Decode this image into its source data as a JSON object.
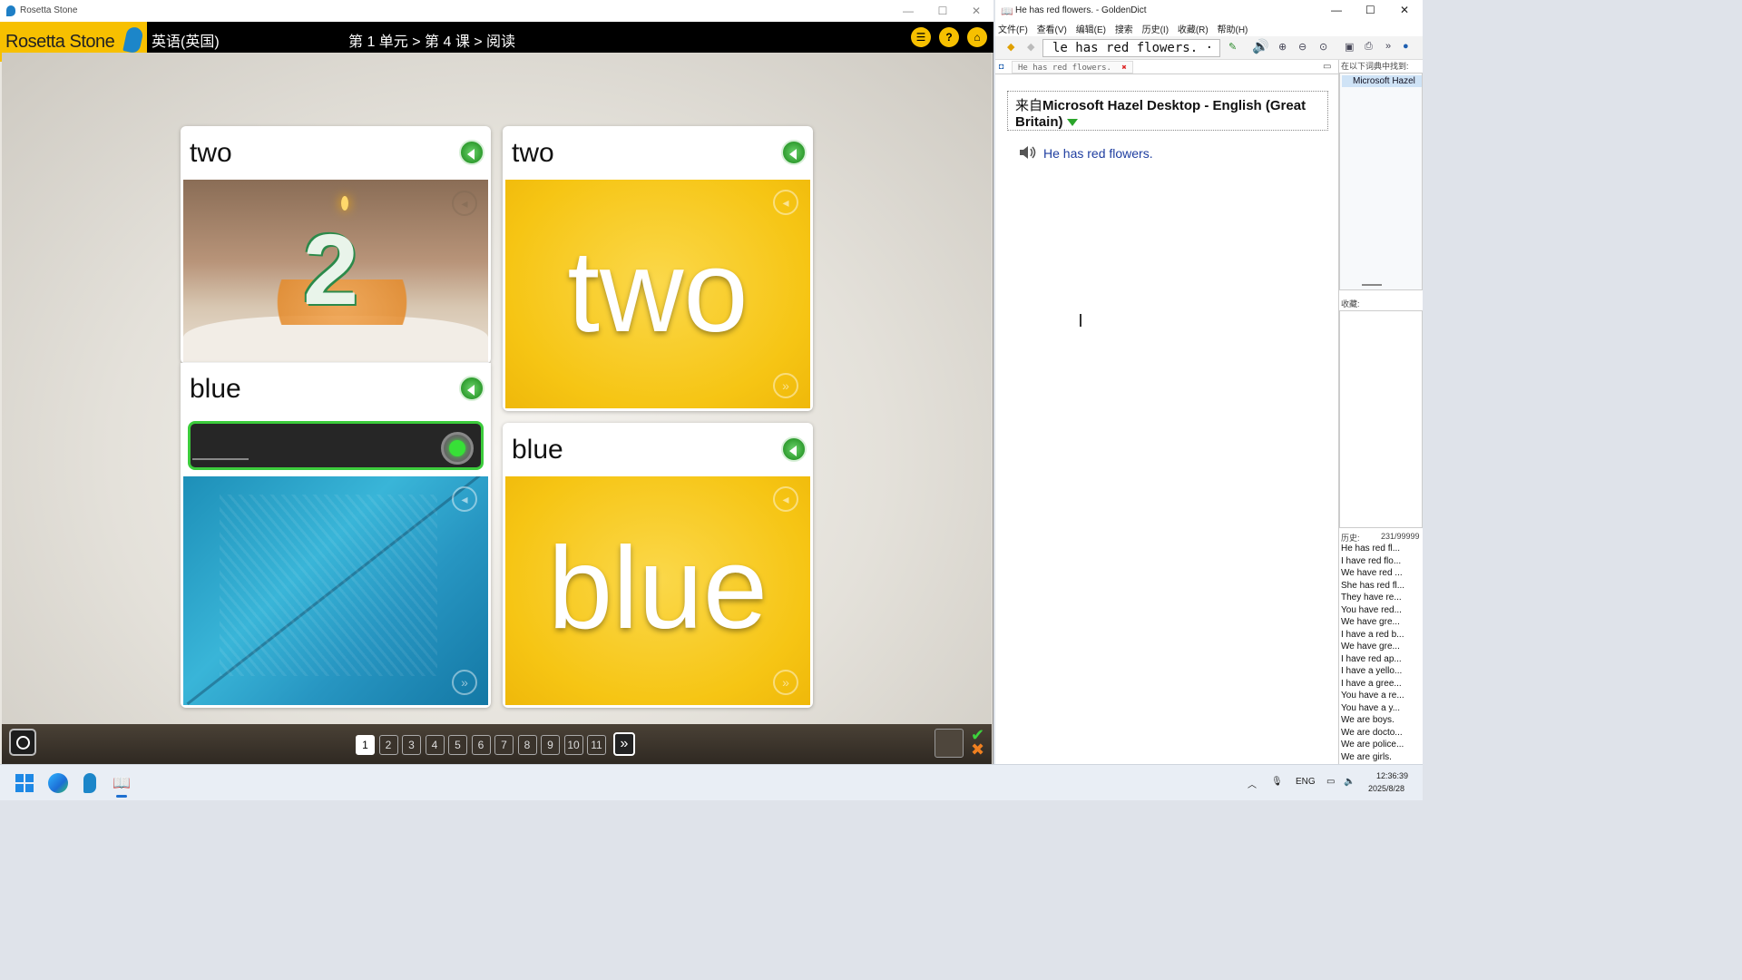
{
  "rosetta": {
    "window_title": "Rosetta Stone",
    "logo_text": "Rosetta Stone",
    "course_language": "英语(英国)",
    "breadcrumb": "第 1 单元 > 第 4 课 > 阅读",
    "cards": [
      {
        "word": "two",
        "image": "birthday-cake-with-number-2-candle"
      },
      {
        "word": "two",
        "big_text": "two"
      },
      {
        "word": "blue",
        "image": "blue-feather"
      },
      {
        "word": "blue",
        "big_text": "blue"
      }
    ],
    "answer_placeholder": "____",
    "pages": [
      "1",
      "2",
      "3",
      "4",
      "5",
      "6",
      "7",
      "8",
      "9",
      "10",
      "11"
    ],
    "current_page": "1",
    "colors": {
      "brand_yellow": "#f7c000",
      "correct_green": "#3ccc3c",
      "card_yellow": "#f6c514"
    }
  },
  "goldendict": {
    "window_title": "He has red flowers. - GoldenDict",
    "menu": [
      "文件(F)",
      "查看(V)",
      "编辑(E)",
      "搜索",
      "历史(I)",
      "收藏(R)",
      "帮助(H)"
    ],
    "search_value": "le has red flowers. ·",
    "tab_label": "He has red flowers.",
    "dict_source_prefix": "来自",
    "dict_name": "Microsoft Hazel Desktop - English (Great Britain)",
    "sentence": "He has red flowers.",
    "found_in_label": "在以下词典中找到:",
    "found_dict": "Microsoft Hazel",
    "favorites_label": "收藏:",
    "history_label": "历史:",
    "history_count": "231/99999",
    "history": [
      "He has red fl...",
      "I have red flo...",
      "We have red ...",
      "She has red fl...",
      "They have re...",
      "You have red...",
      "We have gre...",
      "I have a red b...",
      "We have gre...",
      "I have red ap...",
      "I have a yello...",
      "I have a gree...",
      "You have a re...",
      "You have a y...",
      "We are boys.",
      "We are docto...",
      "We are police...",
      "We are girls."
    ]
  },
  "taskbar": {
    "lang": "ENG",
    "time": "12:36:39",
    "date": "2025/8/28"
  }
}
